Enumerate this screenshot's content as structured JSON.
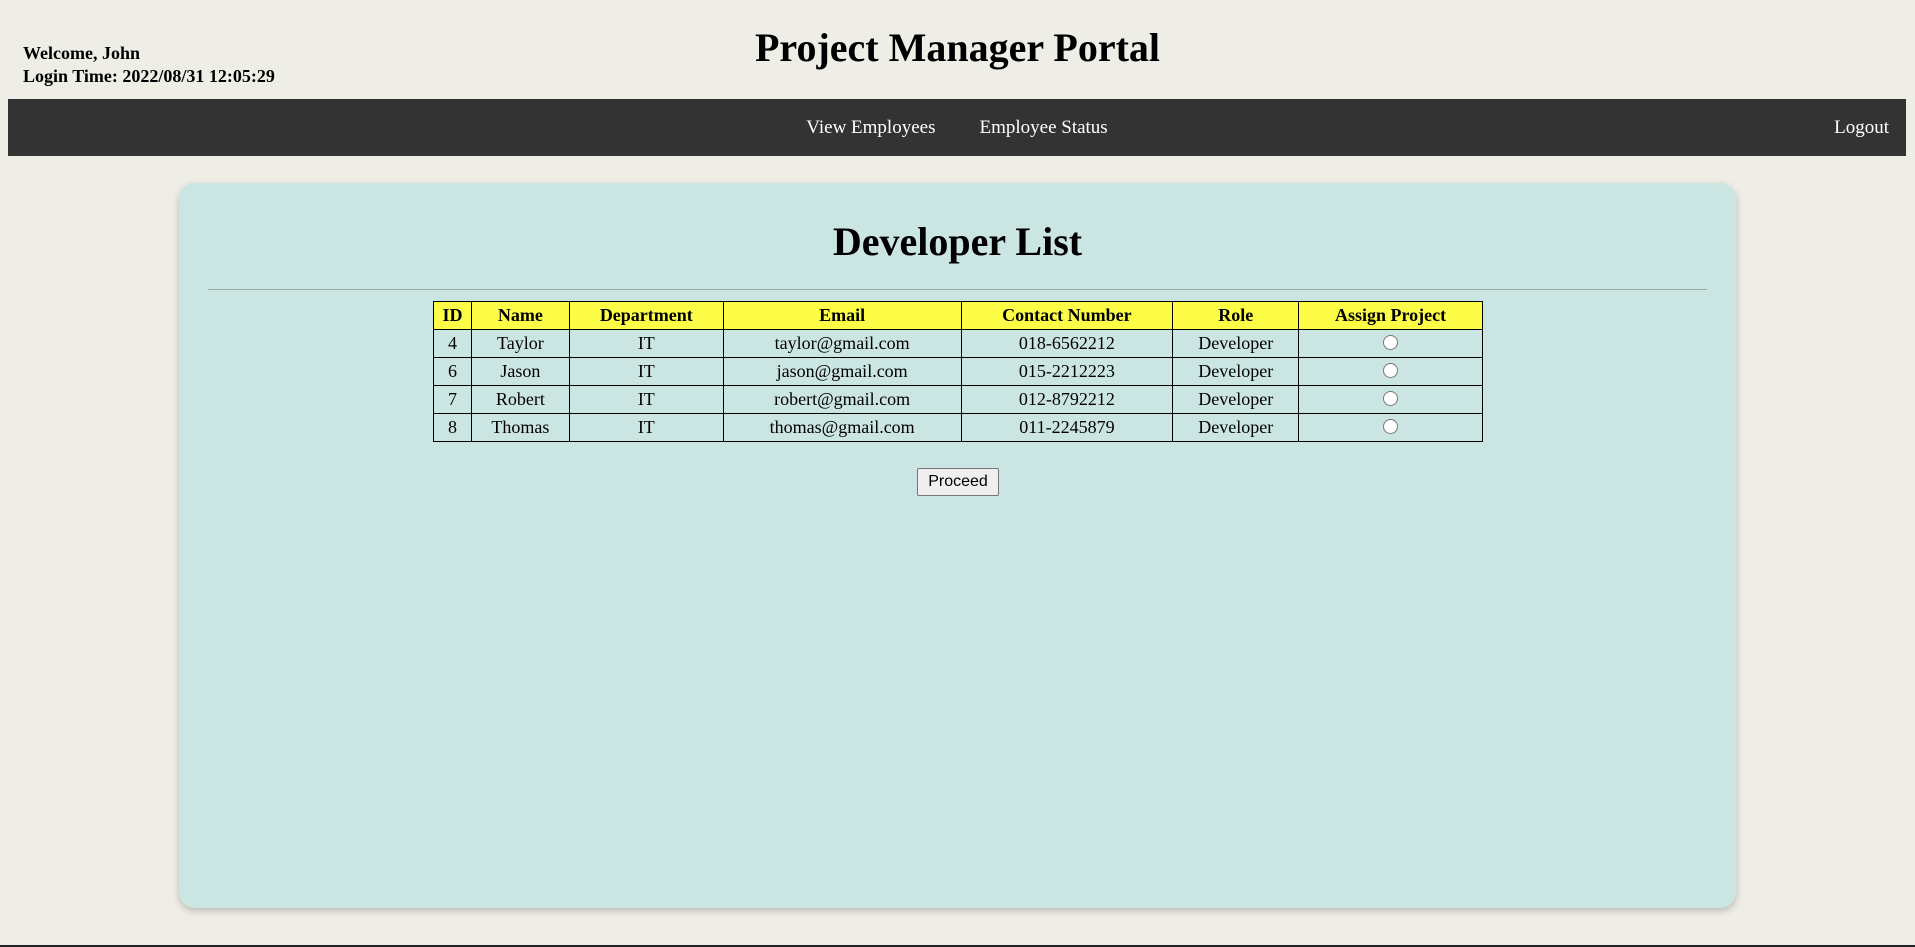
{
  "header": {
    "welcome": "Welcome, John",
    "login_time": "Login Time: 2022/08/31 12:05:29",
    "title": "Project Manager Portal"
  },
  "nav": {
    "view_employees": "View Employees",
    "employee_status": "Employee Status",
    "logout": "Logout"
  },
  "main": {
    "title": "Developer List",
    "table": {
      "columns": [
        "ID",
        "Name",
        "Department",
        "Email",
        "Contact Number",
        "Role",
        "Assign Project"
      ],
      "rows": [
        {
          "id": "4",
          "name": "Taylor",
          "department": "IT",
          "email": "taylor@gmail.com",
          "contact": "018-6562212",
          "role": "Developer"
        },
        {
          "id": "6",
          "name": "Jason",
          "department": "IT",
          "email": "jason@gmail.com",
          "contact": "015-2212223",
          "role": "Developer"
        },
        {
          "id": "7",
          "name": "Robert",
          "department": "IT",
          "email": "robert@gmail.com",
          "contact": "012-8792212",
          "role": "Developer"
        },
        {
          "id": "8",
          "name": "Thomas",
          "department": "IT",
          "email": "thomas@gmail.com",
          "contact": "011-2245879",
          "role": "Developer"
        }
      ]
    },
    "proceed_label": "Proceed"
  },
  "colors": {
    "page_bg": "#efeee6",
    "navbar_bg": "#333333",
    "card_bg": "#cbe5e2",
    "table_header_bg": "#fdfd47"
  }
}
